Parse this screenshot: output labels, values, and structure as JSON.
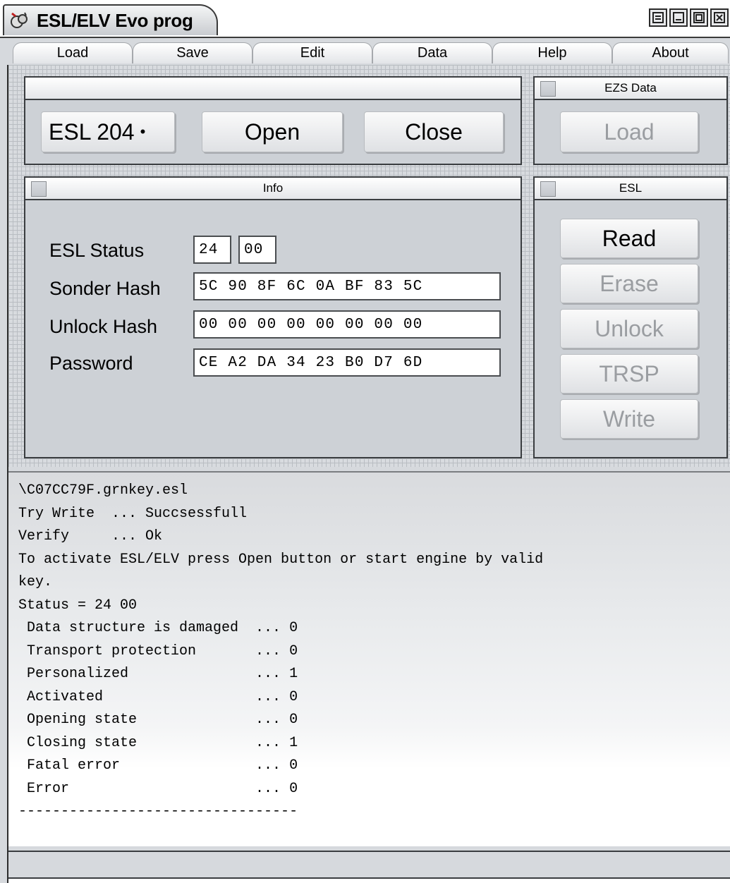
{
  "window": {
    "title": "ESL/ELV Evo prog"
  },
  "menu": [
    {
      "label": "Load"
    },
    {
      "label": "Save"
    },
    {
      "label": "Edit"
    },
    {
      "label": "Data"
    },
    {
      "label": "Help"
    },
    {
      "label": "About"
    }
  ],
  "connect_panel": {
    "title": "",
    "device_select": "ESL 204",
    "open_label": "Open",
    "close_label": "Close"
  },
  "ezs_panel": {
    "title": "EZS Data",
    "load_label": "Load",
    "load_enabled": false
  },
  "info_panel": {
    "title": "Info",
    "esl_status_label": "ESL Status",
    "esl_status_1": "24",
    "esl_status_2": "00",
    "sonder_hash_label": "Sonder Hash",
    "sonder_hash": "5C 90 8F 6C 0A BF 83 5C",
    "unlock_hash_label": "Unlock Hash",
    "unlock_hash": "00 00 00 00 00 00 00 00",
    "password_label": "Password",
    "password": "CE A2 DA 34 23 B0 D7 6D"
  },
  "esl_panel": {
    "title": "ESL",
    "read_label": "Read",
    "erase_label": "Erase",
    "unlock_label": "Unlock",
    "trsp_label": "TRSP",
    "write_label": "Write"
  },
  "log": [
    "\\C07CC79F.grnkey.esl",
    "Try Write  ... Succsessfull",
    "Verify     ... Ok",
    "To activate ESL/ELV press Open button or start engine by valid",
    "key.",
    "Status = 24 00",
    " Data structure is damaged  ... 0",
    " Transport protection       ... 0",
    " Personalized               ... 1",
    " Activated                  ... 0",
    " Opening state              ... 0",
    " Closing state              ... 1",
    " Fatal error                ... 0",
    " Error                      ... 0",
    "---------------------------------"
  ],
  "colors": {
    "panel_bg": "#cdd1d6",
    "disabled_text": "#9a9da1"
  }
}
